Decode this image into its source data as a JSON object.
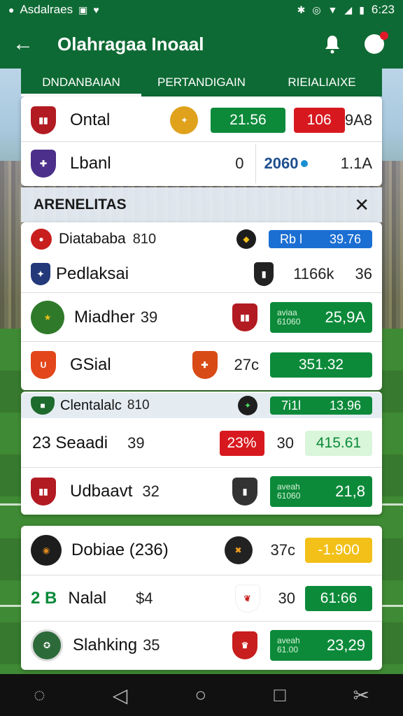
{
  "status_bar": {
    "app_label": "Asdalraes",
    "time": "6:23"
  },
  "app_bar": {
    "title": "Olahragaa Inoaal"
  },
  "tabs": [
    {
      "label": "DNDANBAIAN"
    },
    {
      "label": "PERTANDIGAIN"
    },
    {
      "label": "RIEIALIAIXE"
    }
  ],
  "top_card": {
    "row1": {
      "team": "Ontal",
      "score_a": "21.56",
      "score_b": "106",
      "extra": "9A8"
    },
    "row2": {
      "team": "Lbanl",
      "value": "0",
      "live": "2060",
      "extra": "1.1A"
    }
  },
  "section": {
    "title": "ARENELITAS",
    "close": "✕"
  },
  "matches": [
    {
      "team": "Diatababa",
      "num": "810",
      "pill": "Rb l",
      "odds": "39.76"
    },
    {
      "team": "Pedlaksai",
      "num": "",
      "mid": "1166k",
      "extra": "36"
    },
    {
      "team": "Miadher",
      "num": "39",
      "sub1": "aviaa",
      "sub2": "61060",
      "odds": "25,9A"
    },
    {
      "team": "GSial",
      "num": "",
      "pct": "27c",
      "odds": "351.32"
    },
    {
      "team": "Clentalalc",
      "num": "810",
      "pill": "7i1l",
      "odds": "13.96"
    },
    {
      "team": "23 Seaadi",
      "num": "39",
      "badge": "23%",
      "extra": "30",
      "odds": "415.61"
    },
    {
      "team": "Udbaavt",
      "num": "32",
      "sub1": "aveah",
      "sub2": "61060",
      "odds": "21,8"
    },
    {
      "team": "Dobiae (236)",
      "num": "",
      "pct": "37c",
      "odds": "-1.900"
    },
    {
      "team": "Nalal",
      "prefix": "2 B",
      "num": "$4",
      "extra": "30",
      "odds": "61:66"
    },
    {
      "team": "Slahking",
      "num": "35",
      "sub1": "aveah",
      "sub2": "61.00",
      "odds": "23,29"
    }
  ],
  "colors": {
    "primary": "#0e6a34",
    "odds_green": "#0c8a3a",
    "red": "#d7191f",
    "blue": "#1b6fd3",
    "yellow": "#f2c019"
  }
}
